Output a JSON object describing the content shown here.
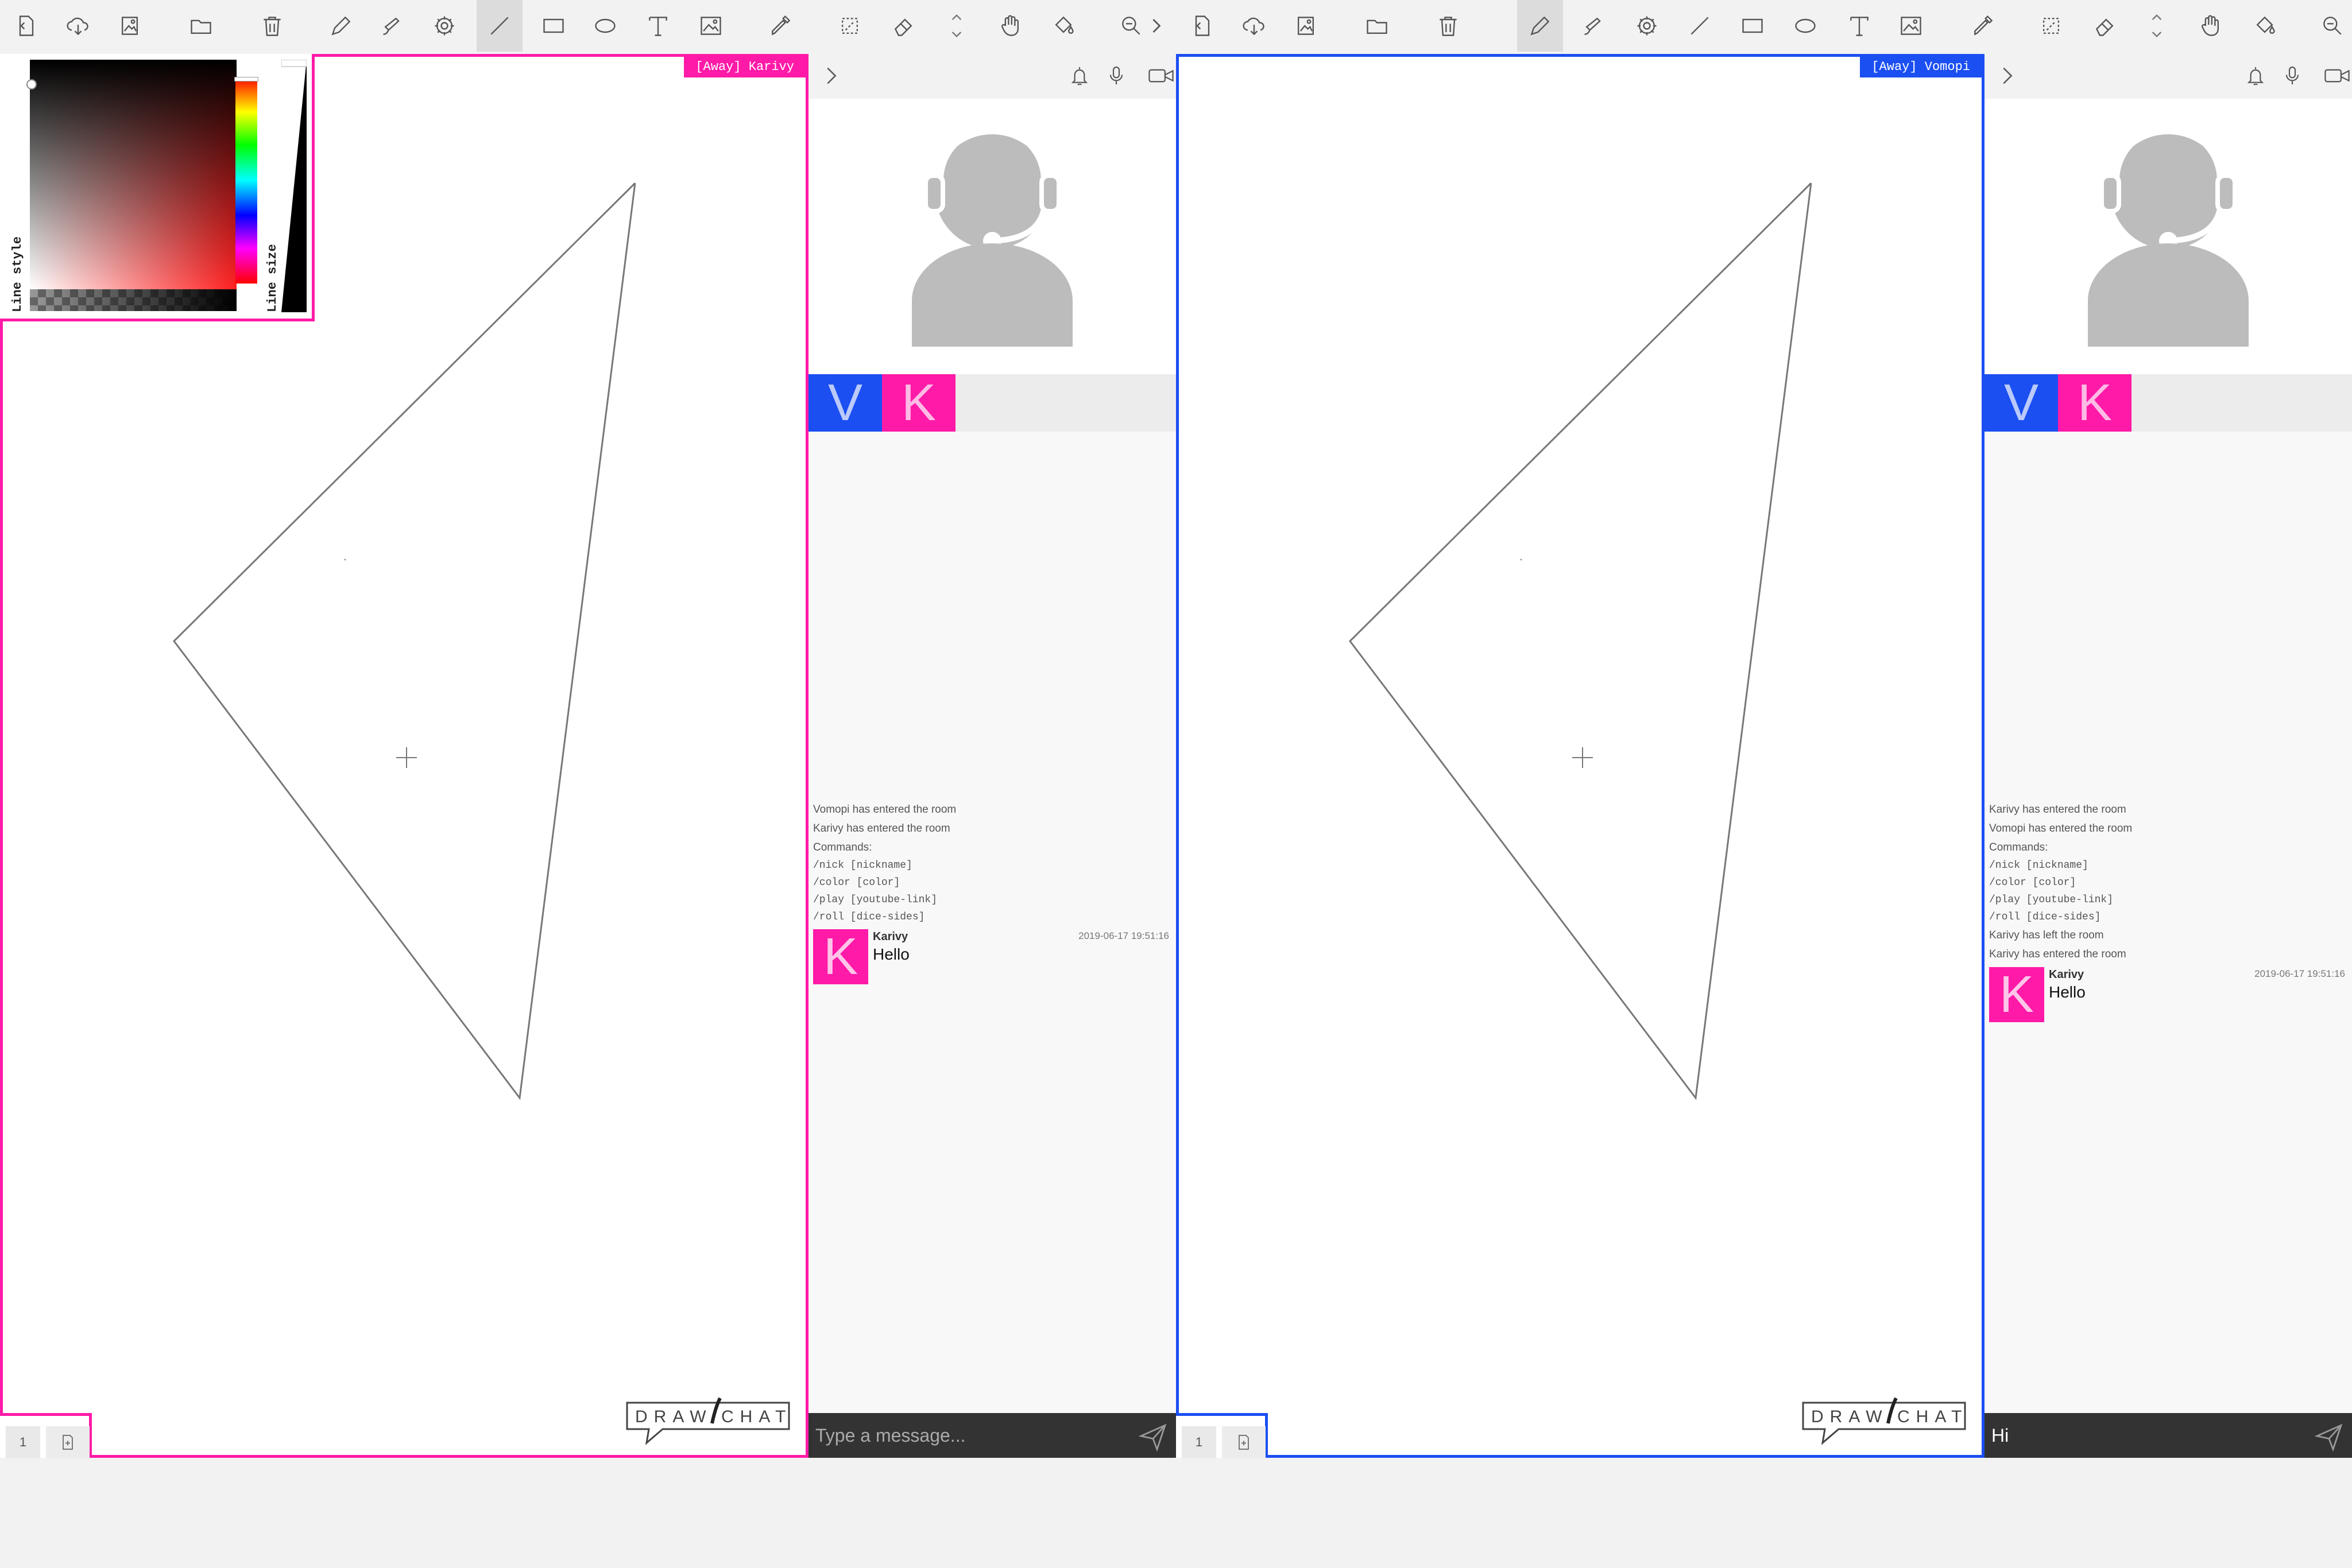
{
  "colors": {
    "karivy": "#ff1aa8",
    "vomopi": "#1b4ff2",
    "toolbar_bg": "#f2f2f2",
    "chat_input_bg": "#333333"
  },
  "toolbar_icons": [
    "new-file-icon",
    "cloud-download-icon",
    "image-export-icon",
    "folder-open-icon",
    "trash-icon",
    "pencil-icon",
    "brush-icon",
    "settings-icon",
    "line-tool-icon",
    "rectangle-icon",
    "ellipse-icon",
    "text-tool-icon",
    "image-insert-icon",
    "eyedropper-icon",
    "eraser-dashed-icon",
    "eraser-icon",
    "scroll-updown-icon",
    "hand-pan-icon",
    "fill-bucket-icon",
    "zoom-icon",
    "chevron-right-icon"
  ],
  "left_panel": {
    "away_tag": "[Away] Karivy",
    "active_tool": "line",
    "color_picker": {
      "line_style_label": "Line style",
      "line_size_label": "Line size"
    },
    "page_number": "1",
    "logo_left": "DRAW",
    "logo_right": "CHAT",
    "users": [
      "V",
      "K"
    ],
    "messages": {
      "system": [
        "Vomopi has entered the room",
        "Karivy has entered the room",
        "Commands:"
      ],
      "commands": [
        "/nick [nickname]",
        "/color [color]",
        "/play [youtube-link]",
        "/roll [dice-sides]"
      ],
      "system_after": [],
      "chat": [
        {
          "initial": "K",
          "user": "Karivy",
          "text": "Hello",
          "time": "2019-06-17 19:51:16"
        }
      ]
    },
    "input": {
      "value": "",
      "placeholder": "Type a message..."
    }
  },
  "right_panel": {
    "away_tag": "[Away] Vomopi",
    "active_tool": "pencil",
    "page_number": "1",
    "logo_left": "DRAW",
    "logo_right": "CHAT",
    "users": [
      "V",
      "K"
    ],
    "messages": {
      "system": [
        "Karivy has entered the room",
        "Vomopi has entered the room",
        "Commands:"
      ],
      "commands": [
        "/nick [nickname]",
        "/color [color]",
        "/play [youtube-link]",
        "/roll [dice-sides]"
      ],
      "system_after": [
        "Karivy has left the room",
        "Karivy has entered the room"
      ],
      "chat": [
        {
          "initial": "K",
          "user": "Karivy",
          "text": "Hello",
          "time": "2019-06-17 19:51:16"
        }
      ]
    },
    "input": {
      "value": "Hi",
      "placeholder": "Type a message..."
    }
  }
}
